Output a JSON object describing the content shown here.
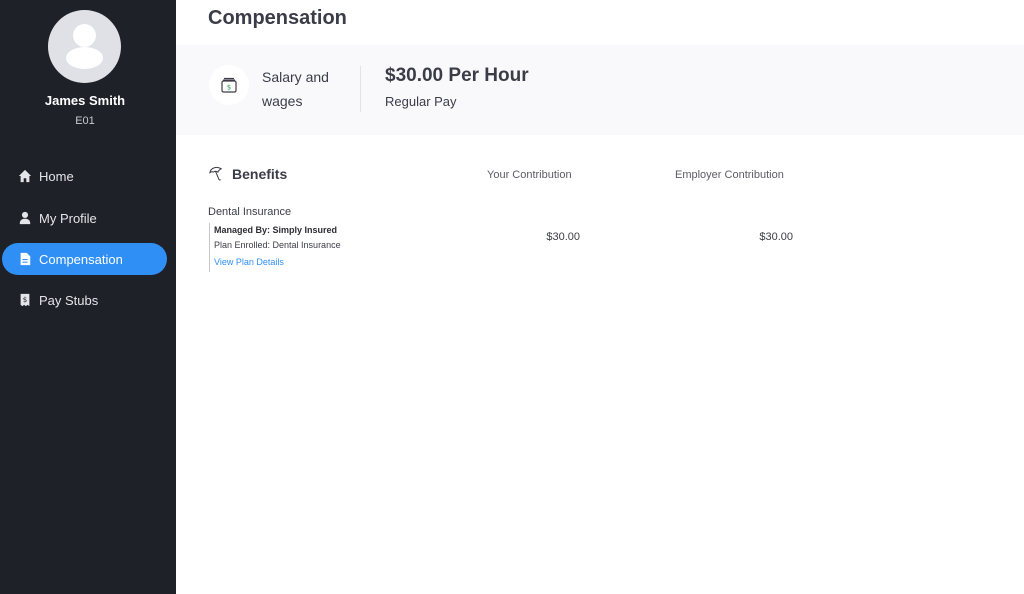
{
  "user": {
    "name": "James Smith",
    "id": "E01"
  },
  "nav": {
    "items": [
      {
        "label": "Home",
        "icon": "home-icon"
      },
      {
        "label": "My Profile",
        "icon": "user-icon"
      },
      {
        "label": "Compensation",
        "icon": "document-icon",
        "active": true
      },
      {
        "label": "Pay Stubs",
        "icon": "pay-stub-icon"
      }
    ]
  },
  "page": {
    "title": "Compensation"
  },
  "salary": {
    "label_line1": "Salary and",
    "label_line2": "wages",
    "amount": "$30.00 Per Hour",
    "type": "Regular Pay"
  },
  "benefits": {
    "title": "Benefits",
    "col_your": "Your Contribution",
    "col_employer": "Employer Contribution",
    "plans": [
      {
        "name": "Dental Insurance",
        "managed_by": "Managed By: Simply Insured",
        "enrolled": "Plan Enrolled: Dental Insurance",
        "link": "View Plan Details",
        "your_contribution": "$30.00",
        "employer_contribution": "$30.00"
      }
    ]
  },
  "colors": {
    "sidebar": "#1f2128",
    "accent": "#2f8ff5",
    "card_bg": "#f9f9fc"
  }
}
